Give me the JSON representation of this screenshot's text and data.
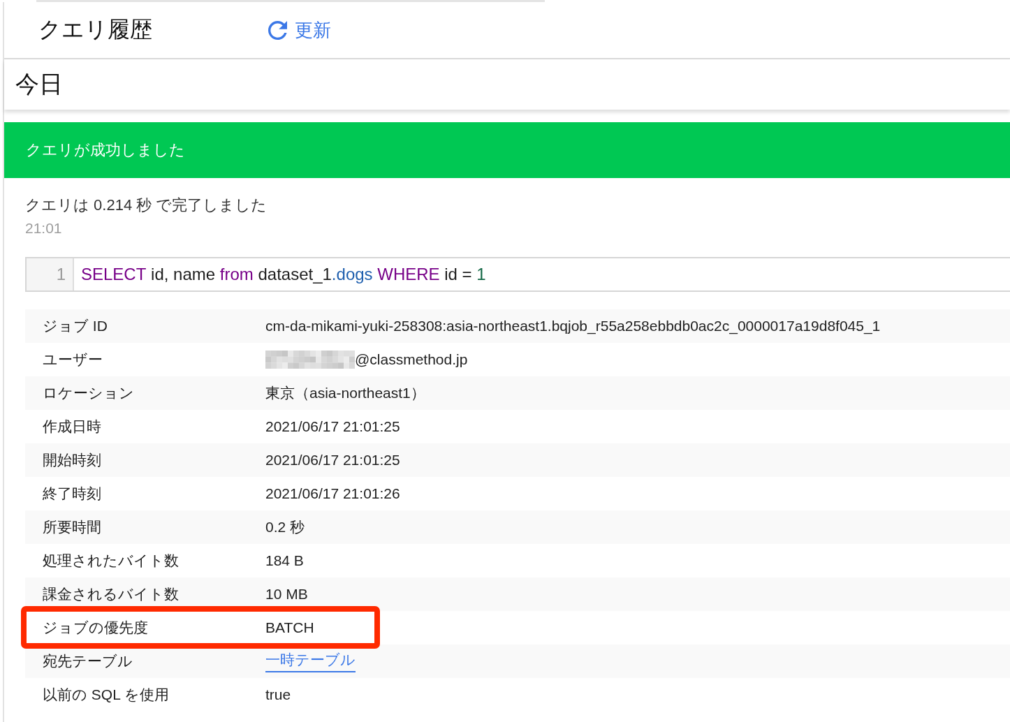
{
  "header": {
    "title": "クエリ履歴",
    "refresh_button": {
      "label": "更新"
    }
  },
  "day_heading": "今日",
  "query": {
    "status_banner": {
      "kind": "success",
      "text": "クエリが成功しました"
    },
    "summary": "クエリは 0.214 秒 で完了しました",
    "time": "21:01",
    "editor": {
      "lines": [
        {
          "number": "1",
          "tokens": [
            {
              "kind": "keyword",
              "text": "SELECT"
            },
            {
              "kind": "plain",
              "text": " id, name "
            },
            {
              "kind": "keyword",
              "text": "from"
            },
            {
              "kind": "plain",
              "text": " dataset_1"
            },
            {
              "kind": "property",
              "text": ".dogs"
            },
            {
              "kind": "keyword",
              "text": " WHERE"
            },
            {
              "kind": "plain",
              "text": " id = "
            },
            {
              "kind": "number",
              "text": "1"
            }
          ]
        }
      ]
    },
    "details": [
      {
        "label": "ジョブ ID",
        "kind": "text",
        "value": "cm-da-mikami-yuki-258308:asia-northeast1.bqjob_r55a258ebbdb0ac2c_0000017a19d8f045_1",
        "highlighted": false
      },
      {
        "label": "ユーザー",
        "kind": "redacted",
        "value": "@classmethod.jp",
        "highlighted": false
      },
      {
        "label": "ロケーション",
        "kind": "text",
        "value": "東京（asia-northeast1）",
        "highlighted": false
      },
      {
        "label": "作成日時",
        "kind": "text",
        "value": "2021/06/17 21:01:25",
        "highlighted": false
      },
      {
        "label": "開始時刻",
        "kind": "text",
        "value": "2021/06/17 21:01:25",
        "highlighted": false
      },
      {
        "label": "終了時刻",
        "kind": "text",
        "value": "2021/06/17 21:01:26",
        "highlighted": false
      },
      {
        "label": "所要時間",
        "kind": "text",
        "value": "0.2 秒",
        "highlighted": false
      },
      {
        "label": "処理されたバイト数",
        "kind": "text",
        "value": "184 B",
        "highlighted": false
      },
      {
        "label": "課金されるバイト数",
        "kind": "text",
        "value": "10 MB",
        "highlighted": false
      },
      {
        "label": "ジョブの優先度",
        "kind": "text",
        "value": "BATCH",
        "highlighted": true
      },
      {
        "label": "宛先テーブル",
        "kind": "link",
        "value": "一時テーブル",
        "highlighted": false
      },
      {
        "label": "以前の SQL を使用",
        "kind": "text",
        "value": "true",
        "highlighted": false
      }
    ]
  }
}
